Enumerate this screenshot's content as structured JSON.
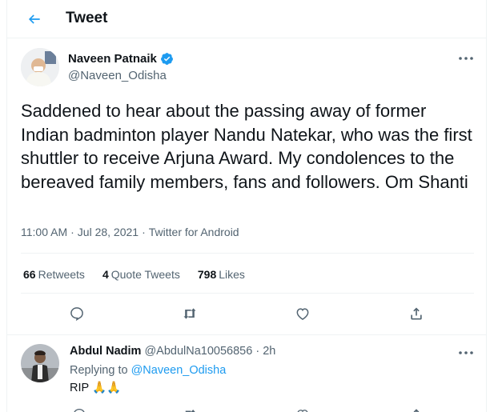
{
  "header": {
    "title": "Tweet",
    "back_icon": "arrow-left-icon"
  },
  "tweet": {
    "author": {
      "name": "Naveen Patnaik",
      "handle": "@Naveen_Odisha",
      "verified": true
    },
    "text": "Saddened to hear about the passing away of former Indian badminton player Nandu Natekar, who was the first shuttler to receive Arjuna Award. My condolences to the bereaved family members, fans and followers. Om Shanti",
    "time": "11:00 AM",
    "date": "Jul 28, 2021",
    "source": "Twitter for Android",
    "stats": {
      "retweets_count": "66",
      "retweets_label": "Retweets",
      "quotes_count": "4",
      "quotes_label": "Quote Tweets",
      "likes_count": "798",
      "likes_label": "Likes"
    }
  },
  "reply": {
    "name": "Abdul Nadim",
    "handle": "@AbdulNa10056856",
    "age": "2h",
    "replying_prefix": "Replying to",
    "replying_handle": "@Naveen_Odisha",
    "text": "RIP 🙏🙏"
  },
  "colors": {
    "accent": "#1d9bf0",
    "secondary": "#536471",
    "verified": "#1d9bf0"
  }
}
